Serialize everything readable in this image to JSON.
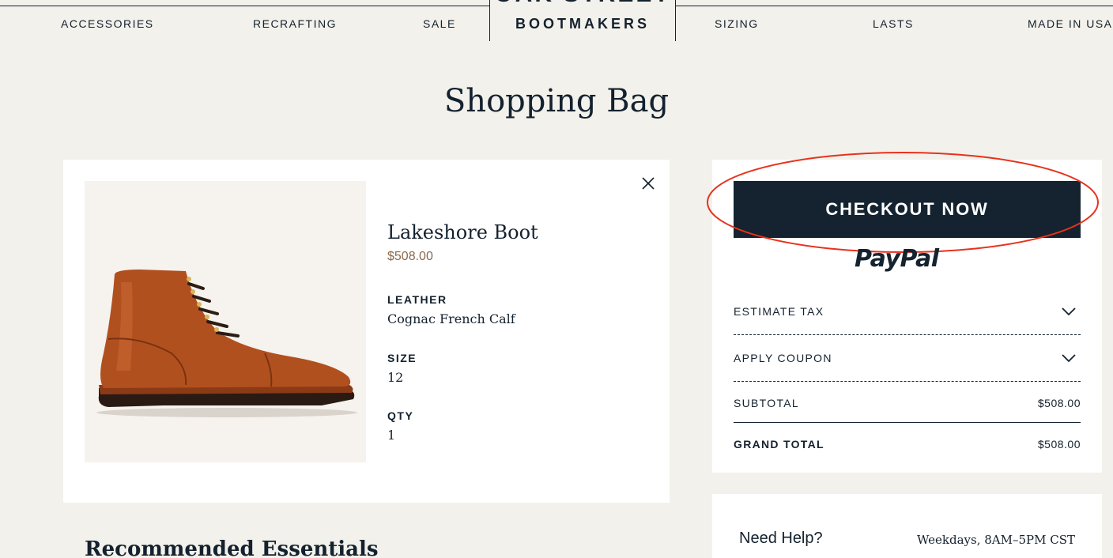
{
  "brand": {
    "logo_top": "OAK STREET",
    "logo_bottom": "BOOTMAKERS"
  },
  "nav": {
    "left": [
      "ACCESSORIES",
      "RECRAFTING",
      "SALE"
    ],
    "right": [
      "SIZING",
      "LASTS",
      "MADE IN USA"
    ]
  },
  "page": {
    "title": "Shopping Bag"
  },
  "cart": {
    "items": [
      {
        "name": "Lakeshore Boot",
        "price": "$508.00",
        "leather_label": "LEATHER",
        "leather": "Cognac French Calf",
        "size_label": "SIZE",
        "size": "12",
        "qty_label": "QTY",
        "qty": "1"
      }
    ]
  },
  "summary": {
    "checkout_label": "CHECKOUT NOW",
    "paypal_label": "PayPal",
    "estimate_tax_label": "ESTIMATE TAX",
    "apply_coupon_label": "APPLY COUPON",
    "subtotal_label": "SUBTOTAL",
    "subtotal_value": "$508.00",
    "grand_total_label": "GRAND TOTAL",
    "grand_total_value": "$508.00"
  },
  "help": {
    "title": "Need Help?",
    "hours": "Weekdays, 8AM–5PM CST"
  },
  "recommended": {
    "title": "Recommended Essentials"
  },
  "colors": {
    "background": "#f2f1eb",
    "navy": "#14232f",
    "price_brown": "#8a6a4c",
    "annotation_red": "#e8321c",
    "boot_leather": "#b1501f"
  }
}
